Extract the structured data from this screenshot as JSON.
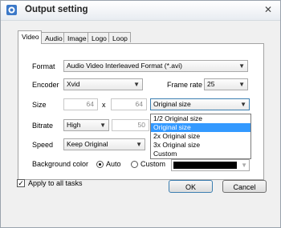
{
  "window": {
    "title": "Output setting"
  },
  "tabs": [
    "Video",
    "Audio",
    "Image",
    "Logo",
    "Loop"
  ],
  "form": {
    "format": {
      "label": "Format",
      "value": "Audio Video Interleaved Format (*.avi)"
    },
    "encoder": {
      "label": "Encoder",
      "value": "Xvid"
    },
    "frame_rate": {
      "label": "Frame rate",
      "value": "25"
    },
    "size": {
      "label": "Size",
      "width": "64",
      "separator": "x",
      "height": "64",
      "preset": "Original size"
    },
    "bitrate": {
      "label": "Bitrate",
      "value": "High",
      "number": "50"
    },
    "speed": {
      "label": "Speed",
      "value": "Keep Original"
    },
    "background": {
      "label": "Background color",
      "auto": "Auto",
      "custom": "Custom",
      "selected": "auto",
      "color": "#000000"
    }
  },
  "size_dropdown": {
    "options": [
      "1/2 Original size",
      "Original size",
      "2x Original size",
      "3x Original size",
      "Custom"
    ],
    "highlighted": "Original size"
  },
  "footer": {
    "apply_all": "Apply to all tasks",
    "apply_checked": true,
    "ok": "OK",
    "cancel": "Cancel"
  }
}
